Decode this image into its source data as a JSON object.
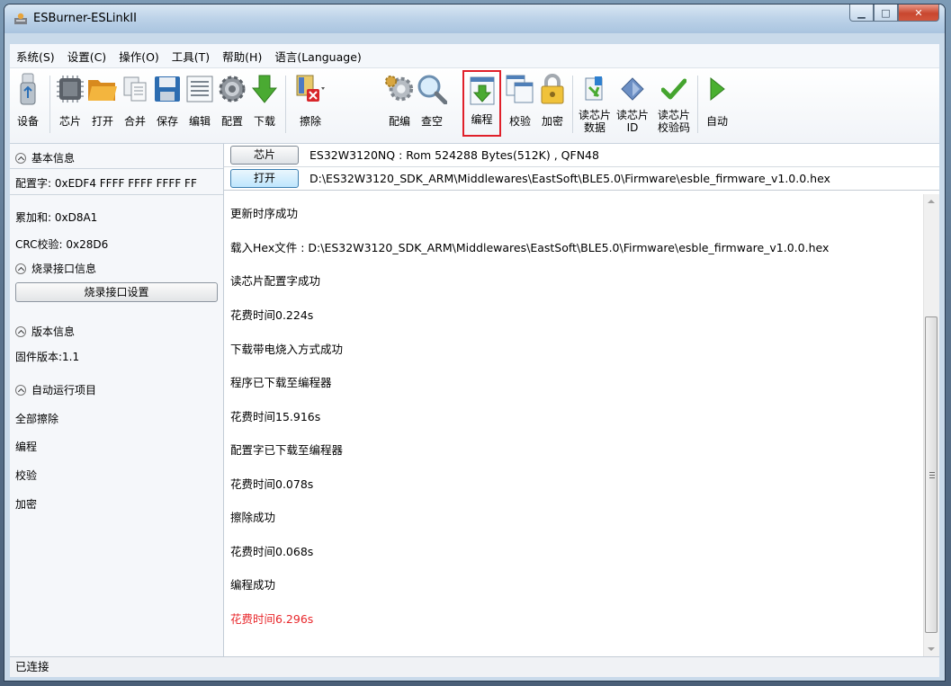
{
  "window": {
    "title": "ESBurner-ESLinkII",
    "minimize_glyph": "▁",
    "maximize_glyph": "□",
    "close_glyph": "✕"
  },
  "menubar": {
    "items": [
      "系统(S)",
      "设置(C)",
      "操作(O)",
      "工具(T)",
      "帮助(H)",
      "语言(Language)"
    ]
  },
  "toolbar": {
    "tools": [
      {
        "label": "设备",
        "icon": "usb-device-icon"
      },
      {
        "label": "芯片",
        "icon": "chip-icon"
      },
      {
        "label": "打开",
        "icon": "open-folder-icon"
      },
      {
        "label": "合并",
        "icon": "merge-icon"
      },
      {
        "label": "保存",
        "icon": "save-floppy-icon"
      },
      {
        "label": "编辑",
        "icon": "edit-list-icon"
      },
      {
        "label": "配置",
        "icon": "config-gear-icon"
      },
      {
        "label": "下载",
        "icon": "download-arrow-icon"
      },
      {
        "label": "擦除",
        "icon": "erase-icon"
      },
      {
        "label": "配编",
        "icon": "config-program-icon"
      },
      {
        "label": "查空",
        "icon": "blank-check-magnifier-icon"
      },
      {
        "label": "编程",
        "icon": "program-icon"
      },
      {
        "label": "校验",
        "icon": "verify-icon"
      },
      {
        "label": "加密",
        "icon": "encrypt-lock-icon"
      },
      {
        "label": "读芯片\n数据",
        "icon": "read-chip-data-icon"
      },
      {
        "label": "读芯片\nID",
        "icon": "read-chip-id-icon"
      },
      {
        "label": "读芯片\n校验码",
        "icon": "read-checksum-icon"
      },
      {
        "label": "自动",
        "icon": "auto-run-icon"
      }
    ],
    "highlight_color": "#e0202a"
  },
  "left_panel": {
    "basic_info_header": "基本信息",
    "config_word": "配置字: 0xEDF4 FFFF FFFF FFFF FF",
    "checksum": "累加和: 0xD8A1",
    "crc": "CRC校验: 0x28D6",
    "burn_interface_header": "烧录接口信息",
    "burn_interface_button": "烧录接口设置",
    "version_header": "版本信息",
    "firmware_version": "固件版本:1.1",
    "auto_run_header": "自动运行项目",
    "auto_items": [
      "全部擦除",
      "编程",
      "校验",
      "加密"
    ]
  },
  "info_rows": {
    "chip_button": "芯片",
    "chip_text": "ES32W3120NQ : Rom 524288 Bytes(512K) , QFN48",
    "open_button": "打开",
    "open_text": "D:\\ES32W3120_SDK_ARM\\Middlewares\\EastSoft\\BLE5.0\\Firmware\\esble_firmware_v1.0.0.hex"
  },
  "log": {
    "lines": [
      "更新时序成功",
      "载入Hex文件 : D:\\ES32W3120_SDK_ARM\\Middlewares\\EastSoft\\BLE5.0\\Firmware\\esble_firmware_v1.0.0.hex",
      "读芯片配置字成功",
      "花费时间0.224s",
      "下载带电烧入方式成功",
      "程序已下载至编程器",
      "花费时间15.916s",
      "配置字已下载至编程器",
      "花费时间0.078s",
      "擦除成功",
      "花费时间0.068s",
      "编程成功",
      "花费时间6.296s"
    ],
    "last_line_color": "#e8262a"
  },
  "statusbar": {
    "text": "已连接"
  }
}
